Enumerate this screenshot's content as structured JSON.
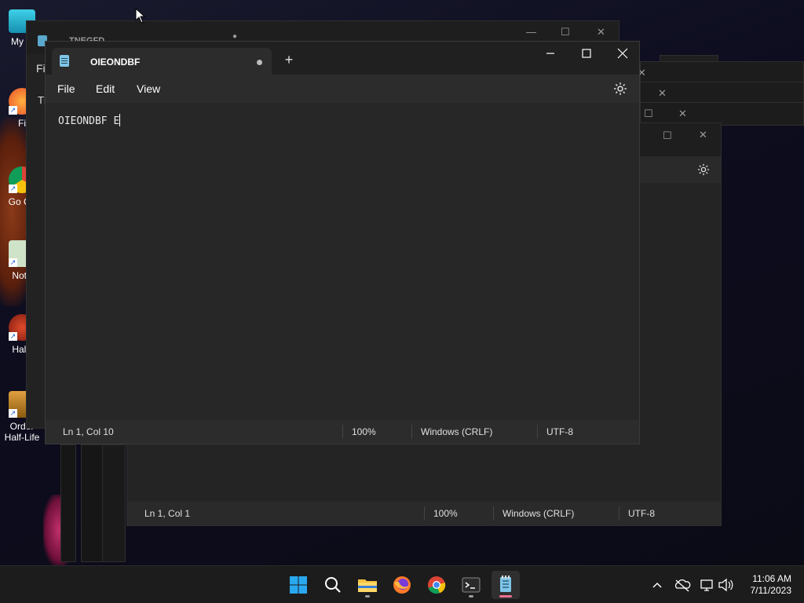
{
  "desktop": {
    "icons": [
      {
        "label": "My C",
        "name": "my-computer"
      },
      {
        "label": "Fi",
        "name": "firefox"
      },
      {
        "label": "Go Ch",
        "name": "google-chrome"
      },
      {
        "label": "Note",
        "name": "notepad"
      },
      {
        "label": "Half-",
        "name": "half-life"
      },
      {
        "label": "Order Half-Life",
        "name": "opposing-force"
      }
    ]
  },
  "background_windows": {
    "title_partial": "TNEGFD",
    "menu_partial": "Fil",
    "text_partial": "Th",
    "status": {
      "position": "Ln 1, Col 1",
      "zoom": "100%",
      "line_ending": "Windows (CRLF)",
      "encoding": "UTF-8"
    }
  },
  "notepad": {
    "tab_title": "OIEONDBF",
    "new_tab_label": "+",
    "menu": {
      "file": "File",
      "edit": "Edit",
      "view": "View"
    },
    "content": "OIEONDBF E",
    "status": {
      "position": "Ln 1, Col 10",
      "zoom": "100%",
      "line_ending": "Windows (CRLF)",
      "encoding": "UTF-8"
    }
  },
  "taskbar": {
    "apps": [
      "start",
      "search",
      "file-explorer",
      "firefox",
      "chrome",
      "terminal",
      "notepad"
    ],
    "clock": {
      "time": "11:06 AM",
      "date": "7/11/2023"
    }
  },
  "colors": {
    "window_bg": "#272727",
    "titlebar_bg": "#202020",
    "taskbar_bg": "#1c1c1c",
    "accent_indicator": "#f07090"
  }
}
